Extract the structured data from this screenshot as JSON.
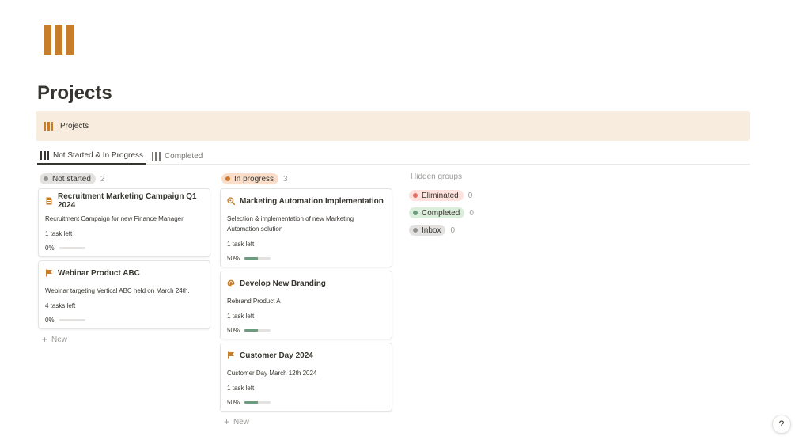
{
  "page": {
    "title": "Projects"
  },
  "callout": {
    "label": "Projects"
  },
  "tabs": [
    {
      "label": "Not Started & In Progress"
    },
    {
      "label": "Completed"
    }
  ],
  "colors": {
    "accent": "#c77d2a",
    "progress_fill": "#6c9b7d"
  },
  "columns": [
    {
      "label": "Not started",
      "count": "2",
      "pill_bg": "#e3e2e0",
      "dot": "#91918e",
      "cards": [
        {
          "title": "Recruitment Marketing Campaign Q1 2024",
          "icon": "document-icon",
          "description": "Recruitment Campaign for new Finance Manager",
          "tasks": "1 task left",
          "progress": "0%",
          "progress_value": 0
        },
        {
          "title": "Webinar Product ABC",
          "icon": "flag-icon",
          "description": "Webinar targeting Vertical ABC held on March 24th.",
          "tasks": "4 tasks left",
          "progress": "0%",
          "progress_value": 0
        }
      ],
      "new_label": "New"
    },
    {
      "label": "In progress",
      "count": "3",
      "pill_bg": "#fadec9",
      "dot": "#cc772f",
      "cards": [
        {
          "title": "Marketing Automation Implementation",
          "icon": "search-gear-icon",
          "description": "Selection & implementation of new Marketing Automation solution",
          "tasks": "1 task left",
          "progress": "50%",
          "progress_value": 0.5
        },
        {
          "title": "Develop New Branding",
          "icon": "palette-icon",
          "description": "Rebrand Product A",
          "tasks": "1 task left",
          "progress": "50%",
          "progress_value": 0.5
        },
        {
          "title": "Customer Day 2024",
          "icon": "flag-icon",
          "description": "Customer Day March 12th 2024",
          "tasks": "1 task left",
          "progress": "50%",
          "progress_value": 0.5
        }
      ],
      "new_label": "New"
    }
  ],
  "hidden_groups": {
    "title": "Hidden groups",
    "items": [
      {
        "label": "Eliminated",
        "count": "0",
        "pill_bg": "#ffe2dd",
        "dot": "#e16f64"
      },
      {
        "label": "Completed",
        "count": "0",
        "pill_bg": "#dbeddb",
        "dot": "#6c9b7d"
      },
      {
        "label": "Inbox",
        "count": "0",
        "pill_bg": "#e3e2e0",
        "dot": "#91918e"
      }
    ]
  },
  "help": {
    "label": "?"
  }
}
